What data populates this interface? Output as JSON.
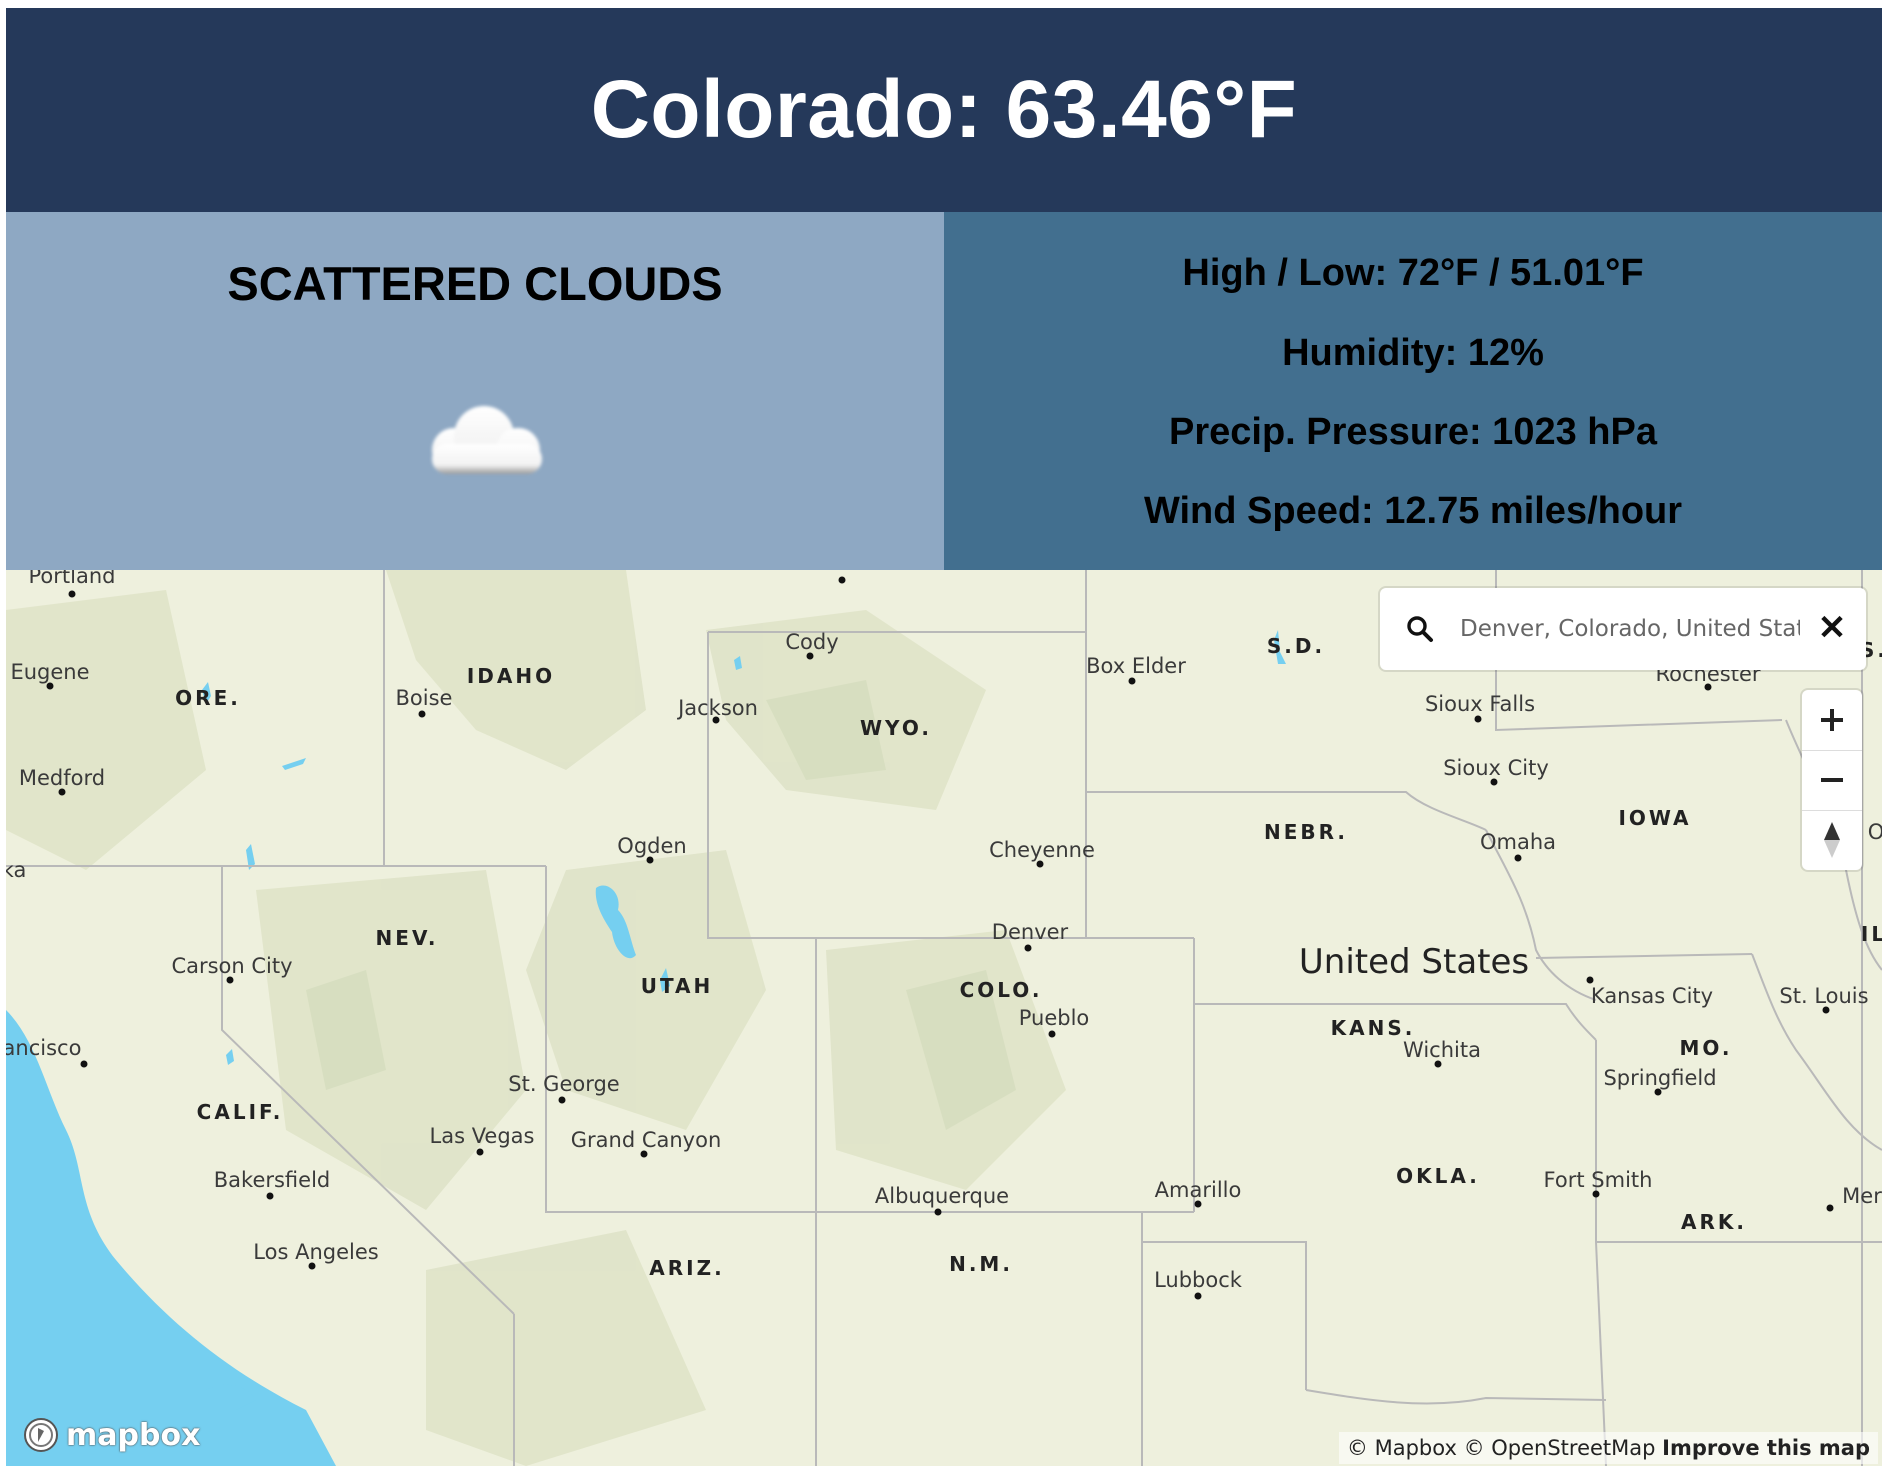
{
  "header": {
    "title": "Colorado: 63.46°F"
  },
  "weather": {
    "description": "SCATTERED CLOUDS",
    "icon": "cloud-icon"
  },
  "stats": {
    "high_low": "High / Low: 72°F / 51.01°F",
    "humidity": "Humidity: 12%",
    "pressure": "Precip. Pressure: 1023 hPa",
    "wind": "Wind Speed: 12.75 miles/hour"
  },
  "map": {
    "search": {
      "value": "Denver, Colorado, United States",
      "clear_icon": "close-icon",
      "search_icon": "search-icon"
    },
    "controls": {
      "zoom_in": "zoom-in-icon",
      "zoom_out": "zoom-out-icon",
      "compass": "compass-icon"
    },
    "logo": "mapbox",
    "attribution": {
      "mapbox": "© Mapbox",
      "osm": "© OpenStreetMap",
      "improve": "Improve this map"
    },
    "country_label": "United States",
    "states": [
      "IDAHO",
      "ORE.",
      "WYO.",
      "S.D.",
      "NEBR.",
      "IOWA",
      "NEV.",
      "UTAH",
      "COLO.",
      "KANS.",
      "MO.",
      "CALIF.",
      "OKLA.",
      "ARK.",
      "ARIZ.",
      "N.M.",
      "S.",
      "IL"
    ],
    "cities": [
      "Portland",
      "Eugene",
      "Medford",
      "Boise",
      "Jackson",
      "Cody",
      "Box Elder",
      "Rochester",
      "Sioux Falls",
      "Sioux City",
      "Omaha",
      "Ogden",
      "Cheyenne",
      "Denver",
      "Pueblo",
      "Carson City",
      "ancisco",
      "ka",
      "St. George",
      "Las Vegas",
      "Grand Canyon",
      "Bakersfield",
      "Los Angeles",
      "Albuquerque",
      "Amarillo",
      "Lubbock",
      "Wichita",
      "Kansas City",
      "St. Louis",
      "Springfield",
      "Fort Smith",
      "Mer",
      "O"
    ]
  },
  "colors": {
    "header_bg": "#25395a",
    "left_panel_bg": "#8ea8c3",
    "right_panel_bg": "#426f8f",
    "map_land": "#eef0dd",
    "map_water": "#75cff0"
  }
}
